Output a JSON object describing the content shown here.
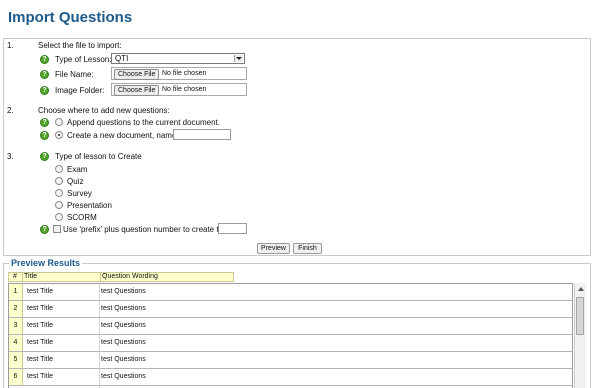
{
  "page": {
    "title": "Import Questions"
  },
  "step1": {
    "number": "1.",
    "heading": "Select the file to import:",
    "type_label": "Type of Lesson:",
    "type_value": "QTI",
    "file_label": "File Name:",
    "file_button": "Choose File",
    "file_status": "No file chosen",
    "image_label": "Image Folder:",
    "image_button": "Choose File",
    "image_status": "No file chosen"
  },
  "step2": {
    "number": "2.",
    "heading": "Choose where to add new questions:",
    "append_label": "Append questions to the current document.",
    "create_label": "Create a new document, named:",
    "selected": "create",
    "new_doc_name": ""
  },
  "step3": {
    "number": "3.",
    "heading": "Type of lesson to Create",
    "options": [
      "Exam",
      "Quiz",
      "Survey",
      "Presentation",
      "SCORM"
    ],
    "prefix_label": "Use 'prefix' plus question number to create title.",
    "prefix_value": "",
    "prefix_checked": false
  },
  "actions": {
    "preview": "Preview",
    "finish": "Finish"
  },
  "results": {
    "legend": "Preview Results",
    "columns": [
      "#",
      "Title",
      "Question Wording"
    ],
    "rows": [
      {
        "num": "1",
        "title": "test Title",
        "wording": "test Questions"
      },
      {
        "num": "2",
        "title": "test Title",
        "wording": "test Questions"
      },
      {
        "num": "3",
        "title": "test Title",
        "wording": "test Questions"
      },
      {
        "num": "4",
        "title": "test Title",
        "wording": "test Questions"
      },
      {
        "num": "5",
        "title": "test Title",
        "wording": "test Questions"
      },
      {
        "num": "6",
        "title": "test Title",
        "wording": "test Questions"
      }
    ]
  },
  "colors": {
    "title": "#1c5a8c",
    "help_icon": "#52a52a",
    "header_fill": "#ffffcc"
  },
  "icons": {
    "help": "help-icon",
    "dropdown": "chevron-down-icon",
    "scroll_up": "scroll-up-arrow-icon"
  }
}
